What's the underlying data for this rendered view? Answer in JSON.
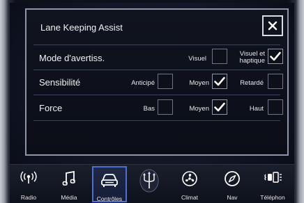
{
  "popup": {
    "title": "Lane Keeping Assist",
    "close_icon": "close-icon"
  },
  "rows": [
    {
      "label": "Mode d'avertiss.",
      "options": [
        {
          "label": "Visuel",
          "checked": false
        },
        {
          "label": "Visuel et haptique",
          "checked": true
        }
      ]
    },
    {
      "label": "Sensibilité",
      "options": [
        {
          "label": "Anticipé",
          "checked": false
        },
        {
          "label": "Moyen",
          "checked": true
        },
        {
          "label": "Retardé",
          "checked": false
        }
      ]
    },
    {
      "label": "Force",
      "options": [
        {
          "label": "Bas",
          "checked": false
        },
        {
          "label": "Moyen",
          "checked": true
        },
        {
          "label": "Haut",
          "checked": false
        }
      ]
    }
  ],
  "nav": {
    "items": [
      {
        "label": "Radio",
        "icon": "radio-icon"
      },
      {
        "label": "Média",
        "icon": "music-note-icon"
      },
      {
        "label": "Contrôles",
        "icon": "car-icon",
        "active": true
      },
      {
        "label": "",
        "icon": "trident-logo-icon"
      },
      {
        "label": "Climat",
        "icon": "fan-icon"
      },
      {
        "label": "Nav",
        "icon": "compass-icon"
      },
      {
        "label": "Téléphon",
        "icon": "phone-icon"
      }
    ]
  },
  "colors": {
    "accent": "#4f6fd0",
    "check": "#ffffff"
  }
}
